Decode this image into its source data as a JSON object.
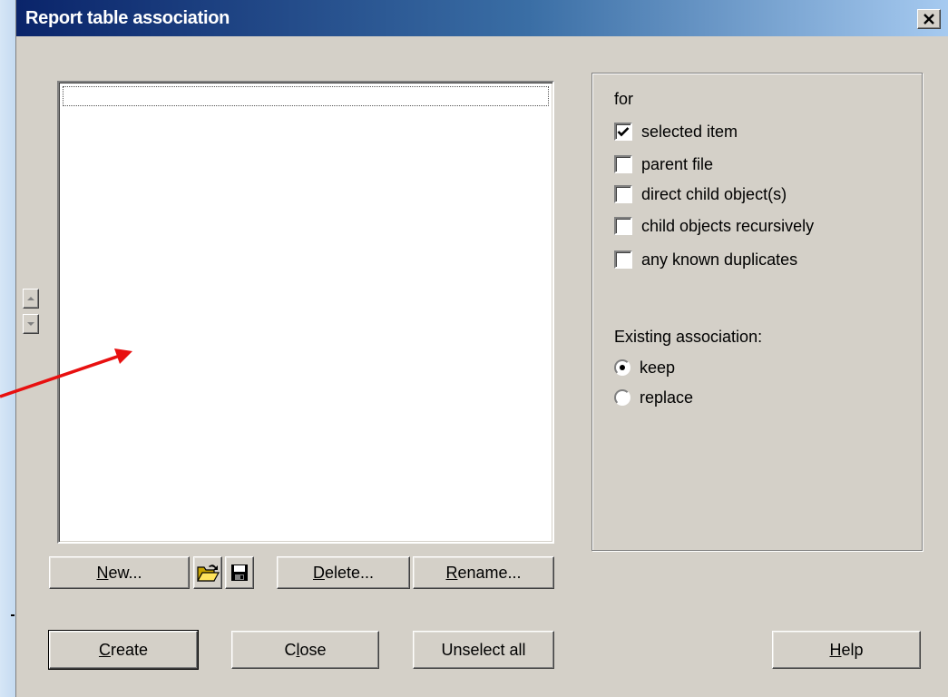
{
  "window": {
    "title": "Report table association",
    "close_glyph": "✕"
  },
  "list": {
    "items": []
  },
  "list_buttons": {
    "new": {
      "accel": "N",
      "rest": "ew..."
    },
    "delete": {
      "accel": "D",
      "rest": "elete..."
    },
    "rename": {
      "accel": "R",
      "rest": "ename..."
    },
    "open_icon": "folder-open-icon",
    "save_icon": "floppy-disk-icon"
  },
  "scope": {
    "heading": "for",
    "options": [
      {
        "label": "selected item",
        "checked": true
      },
      {
        "label": "parent file",
        "checked": false
      },
      {
        "label": "direct child object(s)",
        "checked": false
      },
      {
        "label": "child objects recursively",
        "checked": false
      },
      {
        "label": "any known duplicates",
        "checked": false
      }
    ]
  },
  "existing": {
    "heading": "Existing association:",
    "options": [
      {
        "label": "keep",
        "selected": true
      },
      {
        "label": "replace",
        "selected": false
      }
    ]
  },
  "bottom_buttons": {
    "create": {
      "accel": "C",
      "rest": "reate"
    },
    "close": {
      "pre": "C",
      "accel": "l",
      "rest": "ose"
    },
    "unselect_all": "Unselect all",
    "help": {
      "accel": "H",
      "rest": "elp"
    }
  },
  "colors": {
    "annotation_arrow": "#e81010",
    "dialog_face": "#d4d0c8",
    "title_start": "#0a246a",
    "title_end": "#a6caf0"
  }
}
